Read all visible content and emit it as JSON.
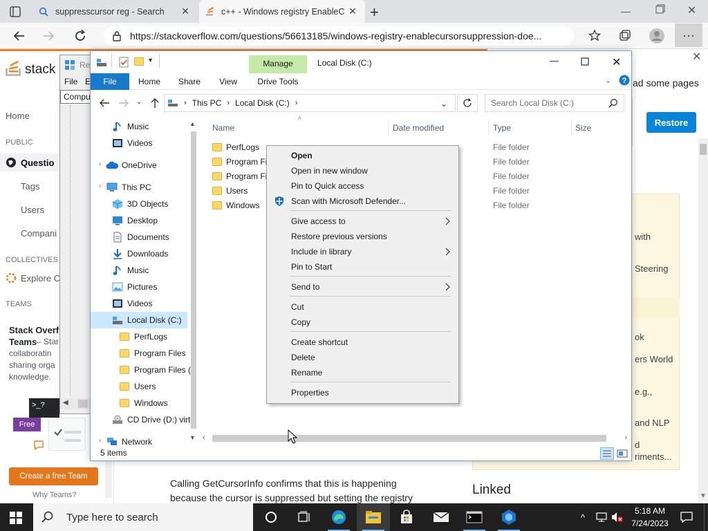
{
  "browser": {
    "tabs": [
      {
        "label": "suppresscursor reg - Search"
      },
      {
        "label": "c++ - Windows registry EnableC"
      }
    ],
    "url": "https://stackoverflow.com/questions/56613185/windows-registry-enablecursorsuppression-doe..."
  },
  "stackoverflow": {
    "logo_text": "stack o",
    "nav": {
      "home": "Home",
      "public": "PUBLIC",
      "questions": "Questio",
      "tags": "Tags",
      "users": "Users",
      "companies": "Compani",
      "collectives": "COLLECTIVES",
      "explore": "Explore C",
      "teams": "TEAMS"
    },
    "teams_promo": {
      "title": "Stack Overfl",
      "title2": "Teams",
      "desc2": " – Star",
      "desc3": "collaboratin",
      "desc4": "sharing orga",
      "desc5": "knowledge.",
      "free_badge": "Free",
      "create_btn": "Create a free Team",
      "why": "Why Teams?"
    },
    "banner_text": "ad some pages",
    "restore_btn": "Restore",
    "right_snippets": [
      "with",
      "Steering",
      "ok",
      "ers World",
      "e.g.,",
      "and NLP",
      "d",
      "riments..."
    ],
    "body_text": "Calling GetCursorInfo confirms that this is happening",
    "body_text2": "because the cursor is suppressed but setting the registry",
    "linked": "Linked"
  },
  "regedit": {
    "title": "Re",
    "menu_file": "File",
    "menu_e": "E",
    "address": "Compu"
  },
  "explorer": {
    "title": "Local Disk (C:)",
    "manage_tab": "Manage",
    "ribbon_tabs": {
      "file": "File",
      "home": "Home",
      "share": "Share",
      "view": "View",
      "drive_tools": "Drive Tools"
    },
    "path": {
      "root": "This PC",
      "current": "Local Disk (C:)"
    },
    "search_placeholder": "Search Local Disk (C:)",
    "nav_pane": [
      {
        "label": "Music",
        "icon": "music-icon"
      },
      {
        "label": "Videos",
        "icon": "video-icon"
      },
      {
        "label": "OneDrive",
        "icon": "cloud-icon"
      },
      {
        "label": "This PC",
        "icon": "computer-icon"
      },
      {
        "label": "3D Objects",
        "icon": "cube-icon"
      },
      {
        "label": "Desktop",
        "icon": "desktop-icon"
      },
      {
        "label": "Documents",
        "icon": "document-icon"
      },
      {
        "label": "Downloads",
        "icon": "download-icon"
      },
      {
        "label": "Music",
        "icon": "music-icon"
      },
      {
        "label": "Pictures",
        "icon": "picture-icon"
      },
      {
        "label": "Videos",
        "icon": "video-icon"
      },
      {
        "label": "Local Disk (C:)",
        "icon": "drive-icon"
      },
      {
        "label": "PerfLogs",
        "icon": "folder-icon"
      },
      {
        "label": "Program Files",
        "icon": "folder-icon"
      },
      {
        "label": "Program Files (",
        "icon": "folder-icon"
      },
      {
        "label": "Users",
        "icon": "folder-icon"
      },
      {
        "label": "Windows",
        "icon": "folder-icon"
      },
      {
        "label": "CD Drive (D:) virt",
        "icon": "cd-icon"
      },
      {
        "label": "Network",
        "icon": "network-icon"
      }
    ],
    "columns": {
      "name": "Name",
      "date": "Date modified",
      "type": "Type",
      "size": "Size"
    },
    "files": [
      {
        "name": "PerfLogs",
        "type": "File folder"
      },
      {
        "name": "Program Fi",
        "type": "File folder"
      },
      {
        "name": "Program Fi",
        "type": "File folder"
      },
      {
        "name": "Users",
        "type": "File folder"
      },
      {
        "name": "Windows",
        "type": "File folder"
      }
    ],
    "status": "5 items"
  },
  "context_menu": {
    "items": [
      {
        "label": "Open"
      },
      {
        "label": "Open in new window"
      },
      {
        "label": "Pin to Quick access"
      },
      {
        "label": "Scan with Microsoft Defender..."
      },
      {
        "label": "Give access to"
      },
      {
        "label": "Restore previous versions"
      },
      {
        "label": "Include in library"
      },
      {
        "label": "Pin to Start"
      },
      {
        "label": "Send to"
      },
      {
        "label": "Cut"
      },
      {
        "label": "Copy"
      },
      {
        "label": "Create shortcut"
      },
      {
        "label": "Delete"
      },
      {
        "label": "Rename"
      },
      {
        "label": "Properties"
      }
    ]
  },
  "taskbar": {
    "search_placeholder": "Type here to search",
    "time": "5:18 AM",
    "date": "7/24/2023"
  },
  "colors": {
    "file_tab": "#1979ca",
    "manage_tab": "#c5e9a8",
    "selection": "#cce8ff",
    "so_orange": "#f48024",
    "restore_btn": "#0a84d8",
    "taskbar": "#1f1f1f"
  }
}
